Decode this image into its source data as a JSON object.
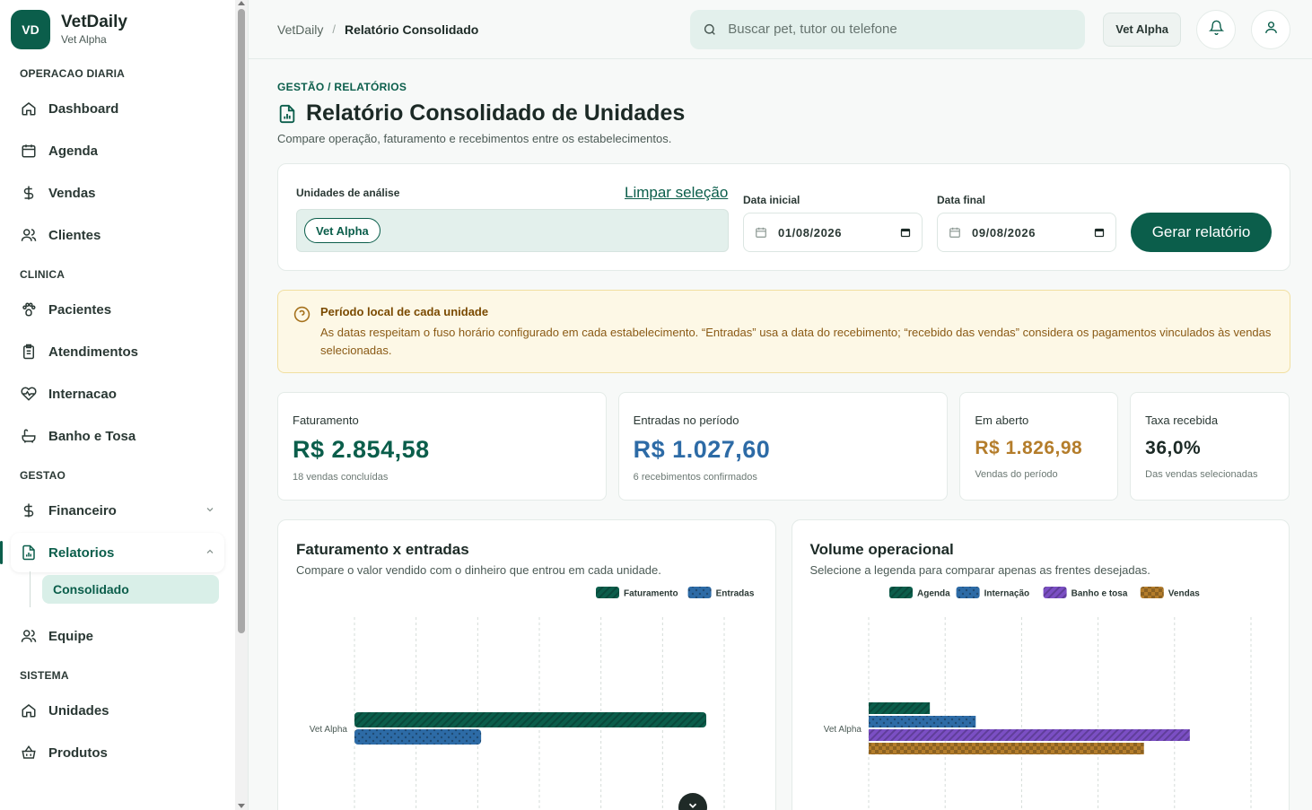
{
  "brand": {
    "initials": "VD",
    "name": "VetDaily",
    "unit": "Vet Alpha"
  },
  "sidebar": {
    "sections": [
      {
        "label": "OPERACAO DIARIA"
      },
      {
        "label": "CLINICA"
      },
      {
        "label": "GESTAO"
      },
      {
        "label": "SISTEMA"
      }
    ],
    "items": {
      "dashboard": "Dashboard",
      "agenda": "Agenda",
      "vendas": "Vendas",
      "clientes": "Clientes",
      "pacientes": "Pacientes",
      "atendimentos": "Atendimentos",
      "internacao": "Internacao",
      "banho": "Banho e Tosa",
      "financeiro": "Financeiro",
      "relatorios": "Relatorios",
      "consolidado": "Consolidado",
      "equipe": "Equipe",
      "unidades": "Unidades",
      "produtos": "Produtos"
    }
  },
  "topbar": {
    "breadcrumb": [
      "VetDaily",
      "Relatório Consolidado"
    ],
    "search_placeholder": "Buscar pet, tutor ou telefone",
    "unit_button": "Vet Alpha"
  },
  "page": {
    "eyebrow": "GESTÃO / RELATÓRIOS",
    "title": "Relatório Consolidado de Unidades",
    "subtitle": "Compare operação, faturamento e recebimentos entre os estabelecimentos."
  },
  "filters": {
    "units_label": "Unidades de análise",
    "clear_label": "Limpar seleção",
    "selected_unit": "Vet Alpha",
    "start_label": "Data inicial",
    "start_value": "01/08/2026",
    "end_label": "Data final",
    "end_value": "09/08/2026",
    "generate_label": "Gerar relatório"
  },
  "notice": {
    "title": "Período local de cada unidade",
    "text": "As datas respeitam o fuso horário configurado em cada estabelecimento. “Entradas” usa a data do recebimento; “recebido das vendas” considera os pagamentos vinculados às vendas selecionadas."
  },
  "kpis": [
    {
      "label": "Faturamento",
      "value": "R$ 2.854,58",
      "note": "18 vendas concluídas",
      "color": "#0b5e4b"
    },
    {
      "label": "Entradas no período",
      "value": "R$ 1.027,60",
      "note": "6 recebimentos confirmados",
      "color": "#2d6ba6"
    },
    {
      "label": "Em aberto",
      "value": "R$ 1.826,98",
      "note": "Vendas do período",
      "color": "#b47d2b"
    },
    {
      "label": "Taxa recebida",
      "value": "36,0%",
      "note": "Das vendas selecionadas",
      "color": "#1c2a26"
    }
  ],
  "chart_data": [
    {
      "type": "bar",
      "orientation": "horizontal",
      "title": "Faturamento x entradas",
      "subtitle": "Compare o valor vendido com o dinheiro que entrou em cada unidade.",
      "categories": [
        "Vet Alpha"
      ],
      "series": [
        {
          "name": "Faturamento",
          "values": [
            2854.58
          ],
          "color": "#0b5e4b"
        },
        {
          "name": "Entradas",
          "values": [
            1027.6
          ],
          "color": "#2d6ba6"
        }
      ],
      "xlim": [
        0,
        3000
      ],
      "grid": true,
      "legend": "top-right"
    },
    {
      "type": "bar",
      "orientation": "horizontal",
      "title": "Volume operacional",
      "subtitle": "Selecione a legenda para comparar apenas as frentes desejadas.",
      "categories": [
        "Vet Alpha"
      ],
      "series": [
        {
          "name": "Agenda",
          "values": [
            2
          ],
          "color": "#0b5e4b"
        },
        {
          "name": "Internação",
          "values": [
            3.5
          ],
          "color": "#2d6ba6"
        },
        {
          "name": "Banho e tosa",
          "values": [
            10.5
          ],
          "color": "#7b4fc4"
        },
        {
          "name": "Vendas",
          "values": [
            9
          ],
          "color": "#b47d2b"
        }
      ],
      "xlim": [
        0,
        12.5
      ],
      "grid": true,
      "legend": "top-center"
    }
  ]
}
